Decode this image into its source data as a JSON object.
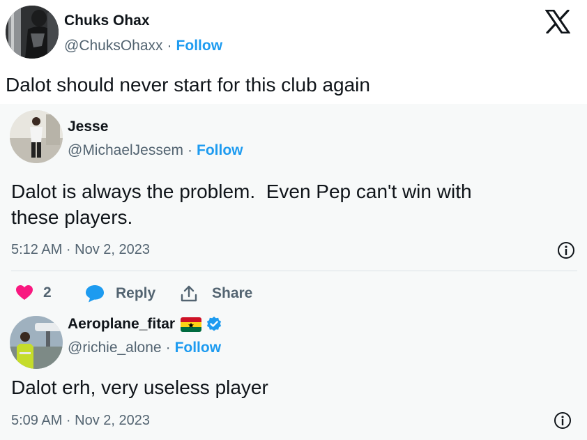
{
  "post": {
    "author_name": "Chuks Ohax",
    "author_handle": "@ChuksOhaxx",
    "separator": "·",
    "follow_label": "Follow",
    "text": "Dalot should never start for this club again",
    "logo_icon": "x-logo-icon"
  },
  "reply1": {
    "author_name": "Jesse",
    "author_handle": "@MichaelJessem",
    "separator": "·",
    "follow_label": "Follow",
    "text_line1": "Dalot is always the problem.  Even Pep can't win with",
    "text_line2": "these players.",
    "timestamp": "5:12 AM · Nov 2, 2023",
    "info_icon": "info-icon",
    "likes_count": "2",
    "reply_label": "Reply",
    "share_label": "Share",
    "icons": [
      "heart-icon",
      "reply-bubble-icon",
      "share-icon"
    ]
  },
  "reply2": {
    "author_name": "Aeroplane_fitar",
    "author_handle": "@richie_alone",
    "separator": "·",
    "follow_label": "Follow",
    "text": "Dalot erh, very useless player",
    "timestamp": "5:09 AM · Nov 2, 2023",
    "info_icon": "info-icon",
    "badges": [
      "ghana-flag-icon",
      "verified-badge-icon"
    ]
  },
  "colors": {
    "accent": "#1d9bf0",
    "like": "#f91880",
    "secondary_text": "#536471",
    "text": "#0f1419",
    "quote_background": "#f7f9f9"
  }
}
